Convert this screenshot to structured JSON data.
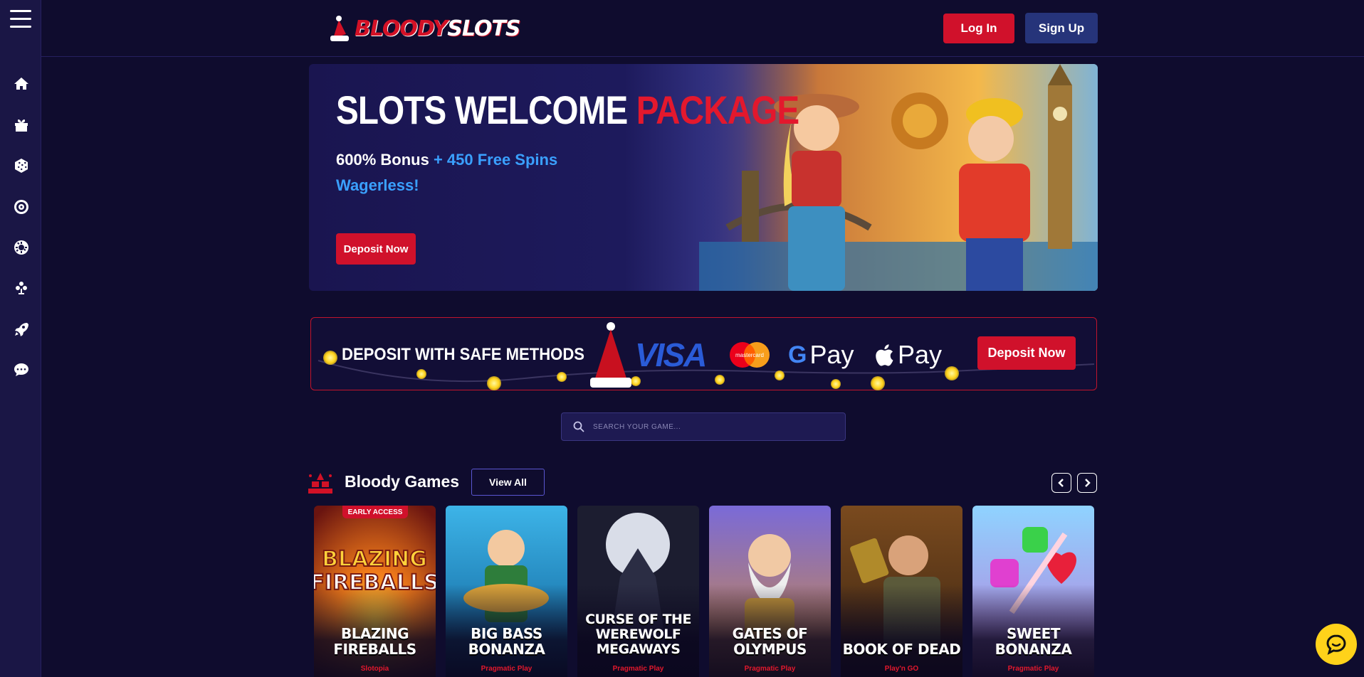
{
  "header": {
    "logo_part1": "BLOODY",
    "logo_part2": "SLOTS",
    "login_label": "Log In",
    "signup_label": "Sign Up"
  },
  "sidebar": {
    "items": [
      {
        "icon": "home-icon"
      },
      {
        "icon": "gift-icon"
      },
      {
        "icon": "dice-icon"
      },
      {
        "icon": "roulette-icon"
      },
      {
        "icon": "poker-chip-icon"
      },
      {
        "icon": "cards-icon"
      },
      {
        "icon": "rocket-icon"
      },
      {
        "icon": "chat-bubble-icon"
      }
    ]
  },
  "hero": {
    "title_white": "SLOTS WELCOME ",
    "title_red": "PACKAGE",
    "sub_white": "600% Bonus ",
    "sub_blue": "+ 450 Free Spins",
    "sub2": "Wagerless!",
    "button_label": "Deposit Now"
  },
  "deposit": {
    "title": "DEPOSIT WITH SAFE METHODS",
    "visa": "VISA",
    "mastercard": "mastercard",
    "gpay": "Pay",
    "applepay": "Pay",
    "button_label": "Deposit Now"
  },
  "search": {
    "placeholder": "SEARCH YOUR GAME..."
  },
  "games": {
    "title": "Bloody Games",
    "view_all": "View All",
    "items": [
      {
        "name": "Blazing Fireballs",
        "provider": "Slotopia",
        "badge": "EARLY ACCESS"
      },
      {
        "name": "Big Bass Bonanza",
        "provider": "Pragmatic Play"
      },
      {
        "name": "Curse of the Werewolf Megaways",
        "provider": "Pragmatic Play"
      },
      {
        "name": "Gates of Olympus",
        "provider": "Pragmatic Play"
      },
      {
        "name": "Book of Dead",
        "provider": "Play'n GO"
      },
      {
        "name": "Sweet Bonanza",
        "provider": "Pragmatic Play"
      }
    ]
  },
  "colors": {
    "accent_red": "#d0112b",
    "accent_blue": "#3aa0ff",
    "bg": "#0f0c2e"
  }
}
